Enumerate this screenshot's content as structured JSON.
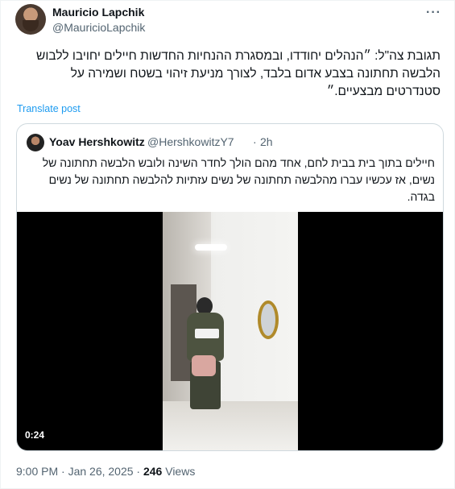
{
  "post": {
    "author_name": "Mauricio Lapchik",
    "author_handle": "@MauricioLapchik",
    "more_icon": "more-icon",
    "text": "תגובת צה\"ל: ״הנהלים יחודדו, ובמסגרת ההנחיות החדשות חיילים יחויבו ללבוש הלבשה תחתונה בצבע אדום בלבד, לצורך מניעת זיהוי בשטח ושמירה על סטנדרטים מבצעיים.״",
    "translate_label": "Translate post",
    "timestamp": "9:00 PM · Jan 26, 2025 · ",
    "views_count": "246",
    "views_label": " Views"
  },
  "quoted": {
    "author_name": "Yoav Hershkowitz",
    "author_handle": "@HershkowitzY7",
    "separator": "·",
    "time": "2h",
    "text": "חיילים בתוך בית בבית לחם, אחד מהם הולך לחדר השינה ולובש הלבשה תחתונה של נשים, אז עכשיו עברו מהלבשה תחתונה של נשים עזתיות להלבשה תחתונה של נשים בגדה.",
    "video_duration": "0:24"
  }
}
